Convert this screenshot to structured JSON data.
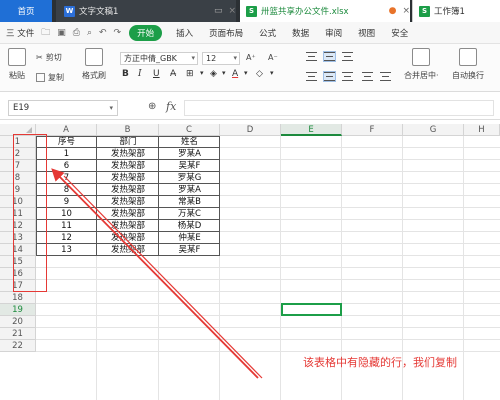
{
  "tabs": {
    "home": "首页",
    "doc_icon": "W",
    "doc": "文字文稿1",
    "xls_icon": "S",
    "xls": "卅篮共享办公文件.xlsx",
    "wb_icon": "S",
    "wb": "工作簿1",
    "close": "×"
  },
  "menu": {
    "file": "三 文件",
    "start": "开始",
    "insert": "插入",
    "page_layout": "页面布局",
    "formula": "公式",
    "data": "数据",
    "review": "审阅",
    "view": "视图",
    "security": "安全"
  },
  "toolbar": {
    "paste": "粘贴",
    "cut": "剪切",
    "copy": "复制",
    "format_painter": "格式刷",
    "font_name": "方正中倩_GBK",
    "font_size": "12",
    "grow_font": "A⁺",
    "shrink_font": "A⁻",
    "bold": "B",
    "italic": "I",
    "underline": "U",
    "merge": "合并居中·",
    "wrap": "自动换行"
  },
  "formula_bar": {
    "cell_ref": "E19",
    "zoom_icon": "⊕",
    "fx_label": "fx"
  },
  "sheet": {
    "columns": [
      "A",
      "B",
      "C",
      "D",
      "E",
      "F",
      "G",
      "H"
    ],
    "active_column": "E",
    "row_numbers": [
      "1",
      "2",
      "7",
      "8",
      "9",
      "10",
      "11",
      "12",
      "13",
      "14",
      "15",
      "16",
      "17",
      "18",
      "19",
      "20",
      "21",
      "22"
    ],
    "active_row": "19",
    "header": [
      "序号",
      "部门",
      "姓名"
    ],
    "rows": [
      [
        "1",
        "发热架部",
        "罗某A"
      ],
      [
        "6",
        "发热架部",
        "吴某F"
      ],
      [
        "7",
        "发热架部",
        "罗某G"
      ],
      [
        "8",
        "发热架部",
        "罗某A"
      ],
      [
        "9",
        "发热架部",
        "常某B"
      ],
      [
        "10",
        "发热架部",
        "万某C"
      ],
      [
        "11",
        "发热架部",
        "杨某D"
      ],
      [
        "12",
        "发热架部",
        "仲某E"
      ],
      [
        "13",
        "发热架部",
        "吴某F"
      ]
    ]
  },
  "annotation": {
    "text": "该表格中有隐藏的行，我们复制",
    "color": "#e53935"
  },
  "colors": {
    "accent": "#1c9e48",
    "home_tab": "#1f6fd6",
    "tabbar": "#2b3034"
  }
}
